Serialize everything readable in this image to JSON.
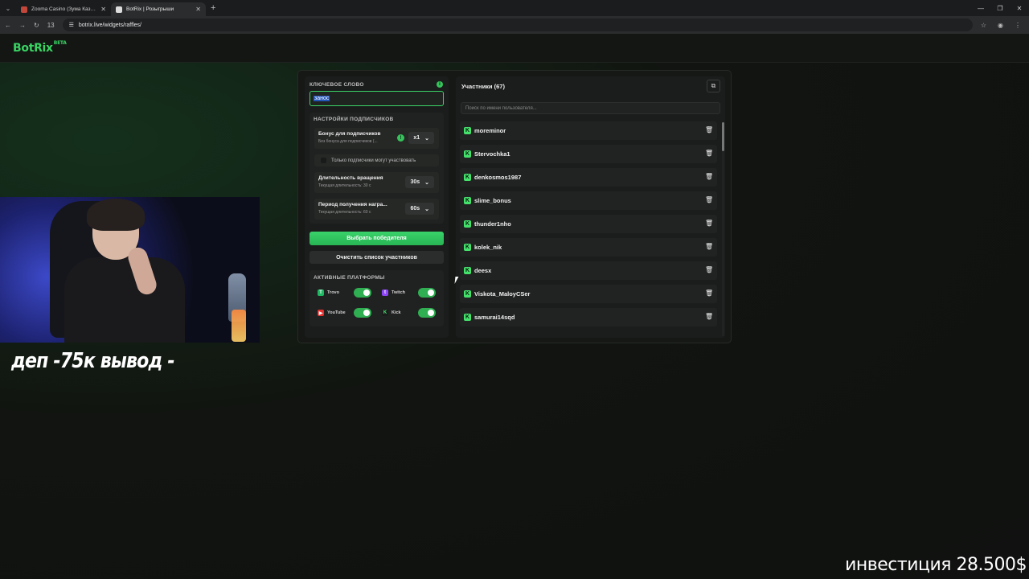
{
  "browser": {
    "tabs": [
      {
        "title": "Zooma Casino (Зума Казино) ·",
        "active": false
      },
      {
        "title": "BotRix | Розыгрыши",
        "active": true
      }
    ],
    "url": "botrix.live/widgets/raffles/",
    "badge_count": "13"
  },
  "site": {
    "logo": "BotRix",
    "logo_badge": "BETA"
  },
  "settings": {
    "keyword_label": "КЛЮЧЕВОЕ СЛОВО",
    "keyword_value": "занос",
    "subs_title": "НАСТРОЙКИ ПОДПИСЧИКОВ",
    "bonus_label": "Бонус для подписчиков",
    "bonus_sub": "Без бонуса для подписчиков (...",
    "bonus_value": "x1",
    "subs_only_label": "Только подписчики могут участвовать",
    "spin_label": "Длительность вращения",
    "spin_sub": "Текущая длительность: 30 с",
    "spin_value": "30s",
    "reward_label": "Период получения награ...",
    "reward_sub": "Текущая длительность: 60 с",
    "reward_value": "60s",
    "pick_winner": "Выбрать победителя",
    "clear_list": "Очистить список участников",
    "platforms_title": "АКТИВНЫЕ ПЛАТФОРМЫ",
    "platforms": [
      {
        "name": "Trovo",
        "enabled": true
      },
      {
        "name": "Twitch",
        "enabled": true
      },
      {
        "name": "YouTube",
        "enabled": true
      },
      {
        "name": "Kick",
        "enabled": true
      }
    ]
  },
  "participants": {
    "title": "Участники (67)",
    "search_placeholder": "Поиск по имени пользователя...",
    "items": [
      "moreminor",
      "Stervochka1",
      "denkosmos1987",
      "slime_bonus",
      "thunder1nho",
      "kolek_nik",
      "deesx",
      "Viskota_MaloyCSer",
      "samurai14sqd"
    ]
  },
  "overlay": {
    "left_text": "деп -75к вывод -",
    "right_text": "инвестиция 28.500$"
  },
  "colors": {
    "accent": "#39d463",
    "bg": "#111210",
    "panel": "#1b1d1c"
  }
}
